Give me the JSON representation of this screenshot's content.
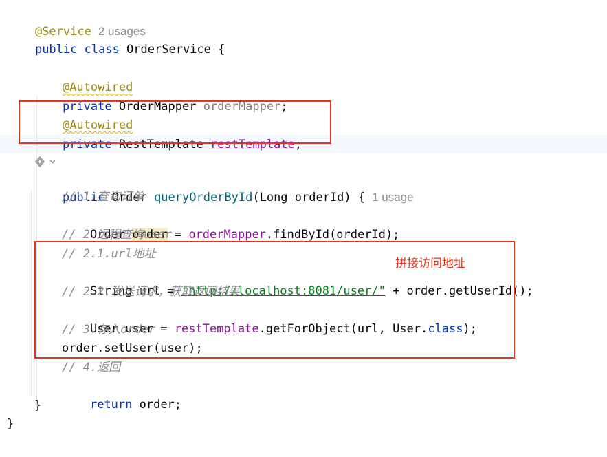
{
  "editor": {
    "class_header": {
      "annotation": "@Service",
      "usages": "2 usages",
      "kw_public": "public",
      "kw_class": "class",
      "class_name": "OrderService",
      "open_brace": "{"
    },
    "field1": {
      "annotation": "@Autowired",
      "kw_private": "private",
      "type": "OrderMapper",
      "name": "orderMapper",
      "semicolon": ";"
    },
    "field2": {
      "annotation": "@Autowired",
      "kw_private": "private",
      "type": "RestTemplate",
      "name": "restTemplate",
      "semicolon": ";"
    },
    "method": {
      "kw_public": "public",
      "return_type": "Order",
      "name": "queryOrderById",
      "params": "(Long orderId) {",
      "usages": "1 usage",
      "body": {
        "c1": "// 1.查询订单",
        "l1_type": "Order",
        "l1_var": "order",
        "l1_eq": "=",
        "l1_obj": "orderMapper",
        "l1_rest": ".findById(orderId);",
        "c2": "// 2.远程查询user",
        "c21": "// 2.1.url地址",
        "l2_prefix": "String url = ",
        "l2_str": "\"http://localhost:8081/user/\"",
        "l2_rest": " + order.getUserId();",
        "c22": "// 2.2.发送请求，获取返回结果",
        "l3_prefix": "User user = ",
        "l3_obj": "restTemplate",
        "l3_mid": ".getForObject(url, User.",
        "l3_kw": "class",
        "l3_end": ");",
        "c3": "// 3.存入order",
        "l4": "order.setUser(user);",
        "c4": "// 4.返回",
        "l5_kw": "return",
        "l5_rest": " order;",
        "close_method": "}",
        "close_class": "}"
      }
    },
    "gutter_icon": "spring-bean-icon"
  },
  "annotation_label": "拼接访问地址",
  "colors": {
    "highlight_box": "#e8341c",
    "keyword": "#0033b3",
    "annotation": "#9e880d",
    "field": "#871094",
    "comment": "#8c8c8c",
    "string": "#067d17",
    "method_decl": "#00627a"
  }
}
